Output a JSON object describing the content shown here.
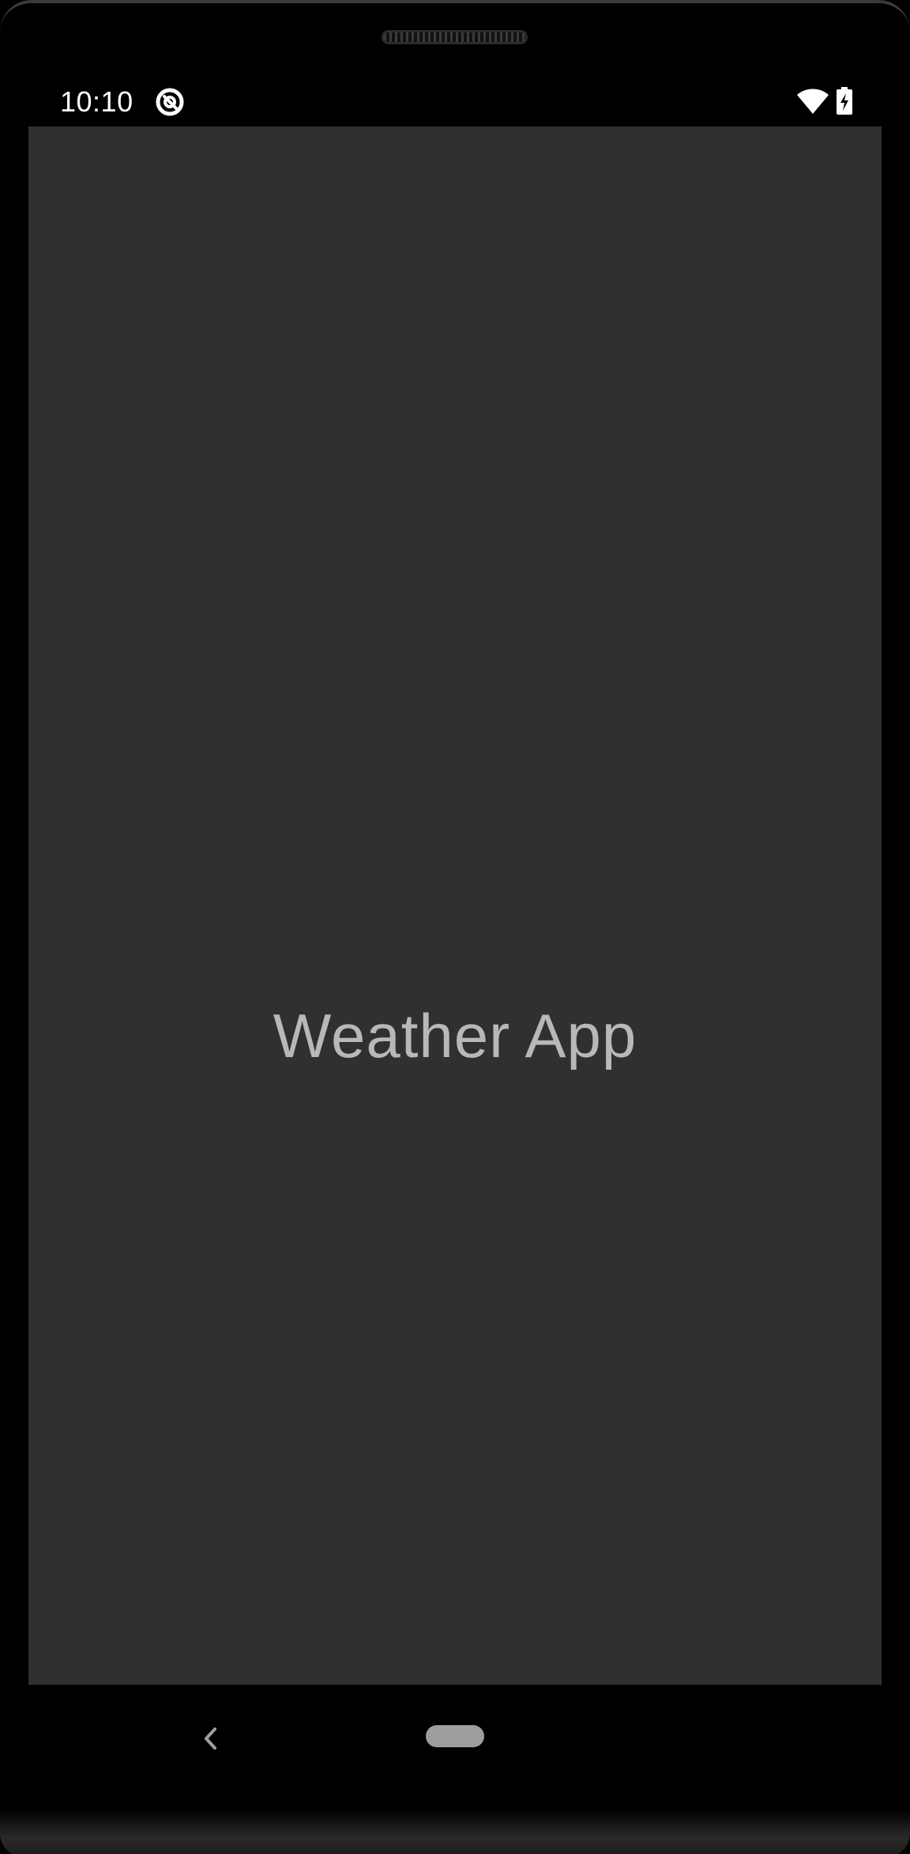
{
  "status_bar": {
    "time": "10:10",
    "icons": [
      "app-notification-icon",
      "wifi-icon",
      "battery-charging-icon"
    ]
  },
  "screen": {
    "title": "Weather App",
    "background": "#303030",
    "title_color": "#b8b8b8"
  },
  "nav_bar": {
    "icons": [
      "back-icon",
      "home-pill"
    ]
  }
}
